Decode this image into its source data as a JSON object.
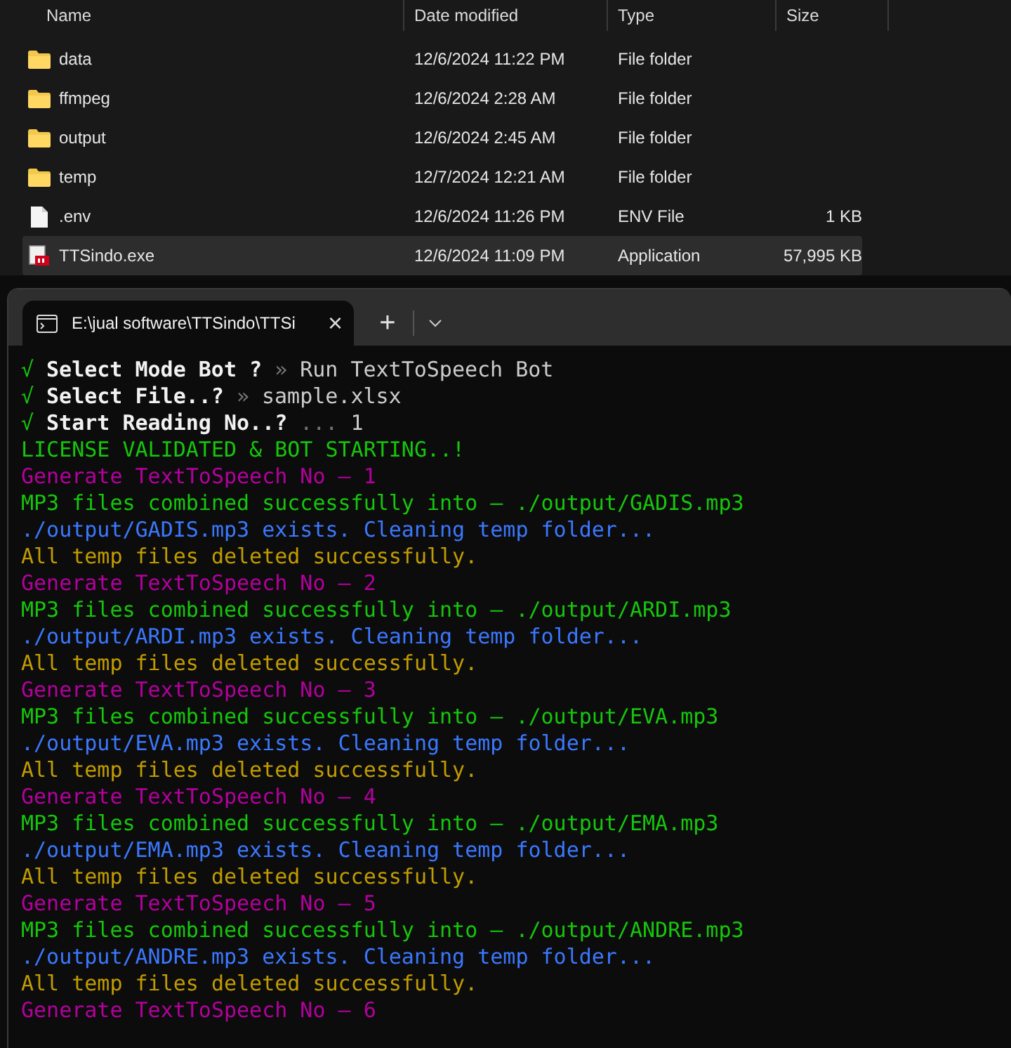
{
  "explorer": {
    "columns": [
      "Name",
      "Date modified",
      "Type",
      "Size"
    ],
    "rows": [
      {
        "kind": "folder",
        "name": "data",
        "date": "12/6/2024 11:22 PM",
        "type": "File folder",
        "size": "",
        "selected": false
      },
      {
        "kind": "folder",
        "name": "ffmpeg",
        "date": "12/6/2024 2:28 AM",
        "type": "File folder",
        "size": "",
        "selected": false
      },
      {
        "kind": "folder",
        "name": "output",
        "date": "12/6/2024 2:45 AM",
        "type": "File folder",
        "size": "",
        "selected": false
      },
      {
        "kind": "folder",
        "name": "temp",
        "date": "12/7/2024 12:21 AM",
        "type": "File folder",
        "size": "",
        "selected": false
      },
      {
        "kind": "file",
        "name": ".env",
        "date": "12/6/2024 11:26 PM",
        "type": "ENV File",
        "size": "1 KB",
        "selected": false
      },
      {
        "kind": "app",
        "name": "TTSindo.exe",
        "date": "12/6/2024 11:09 PM",
        "type": "Application",
        "size": "57,995 KB",
        "selected": true
      }
    ]
  },
  "terminal": {
    "tab": {
      "title": "E:\\jual software\\TTSindo\\TTSi",
      "close": "×"
    },
    "new_tab": "+",
    "lines": [
      {
        "kind": "prompt",
        "check": "√",
        "label": "Select Mode Bot ?",
        "sep": "»",
        "answer": "Run TextToSpeech Bot"
      },
      {
        "kind": "prompt",
        "check": "√",
        "label": "Select File..?",
        "sep": "»",
        "answer": "sample.xlsx"
      },
      {
        "kind": "prompt",
        "check": "√",
        "label": "Start Reading No..?",
        "sep": "...",
        "answer": "1"
      },
      {
        "kind": "log",
        "text": "LICENSE VALIDATED & BOT STARTING..!",
        "color": "#16c60c"
      },
      {
        "kind": "log",
        "text": "Generate TextToSpeech No – 1",
        "color": "#b4009e"
      },
      {
        "kind": "log",
        "text": "MP3 files combined successfully into – ./output/GADIS.mp3",
        "color": "#16c60c"
      },
      {
        "kind": "log",
        "text": "./output/GADIS.mp3 exists. Cleaning temp folder...",
        "color": "#3b78ff"
      },
      {
        "kind": "log",
        "text": "All temp files deleted successfully.",
        "color": "#c19c00"
      },
      {
        "kind": "log",
        "text": "Generate TextToSpeech No – 2",
        "color": "#b4009e"
      },
      {
        "kind": "log",
        "text": "MP3 files combined successfully into – ./output/ARDI.mp3",
        "color": "#16c60c"
      },
      {
        "kind": "log",
        "text": "./output/ARDI.mp3 exists. Cleaning temp folder...",
        "color": "#3b78ff"
      },
      {
        "kind": "log",
        "text": "All temp files deleted successfully.",
        "color": "#c19c00"
      },
      {
        "kind": "log",
        "text": "Generate TextToSpeech No – 3",
        "color": "#b4009e"
      },
      {
        "kind": "log",
        "text": "MP3 files combined successfully into – ./output/EVA.mp3",
        "color": "#16c60c"
      },
      {
        "kind": "log",
        "text": "./output/EVA.mp3 exists. Cleaning temp folder...",
        "color": "#3b78ff"
      },
      {
        "kind": "log",
        "text": "All temp files deleted successfully.",
        "color": "#c19c00"
      },
      {
        "kind": "log",
        "text": "Generate TextToSpeech No – 4",
        "color": "#b4009e"
      },
      {
        "kind": "log",
        "text": "MP3 files combined successfully into – ./output/EMA.mp3",
        "color": "#16c60c"
      },
      {
        "kind": "log",
        "text": "./output/EMA.mp3 exists. Cleaning temp folder...",
        "color": "#3b78ff"
      },
      {
        "kind": "log",
        "text": "All temp files deleted successfully.",
        "color": "#c19c00"
      },
      {
        "kind": "log",
        "text": "Generate TextToSpeech No – 5",
        "color": "#b4009e"
      },
      {
        "kind": "log",
        "text": "MP3 files combined successfully into – ./output/ANDRE.mp3",
        "color": "#16c60c"
      },
      {
        "kind": "log",
        "text": "./output/ANDRE.mp3 exists. Cleaning temp folder...",
        "color": "#3b78ff"
      },
      {
        "kind": "log",
        "text": "All temp files deleted successfully.",
        "color": "#c19c00"
      },
      {
        "kind": "log",
        "text": "Generate TextToSpeech No – 6",
        "color": "#b4009e"
      }
    ]
  }
}
